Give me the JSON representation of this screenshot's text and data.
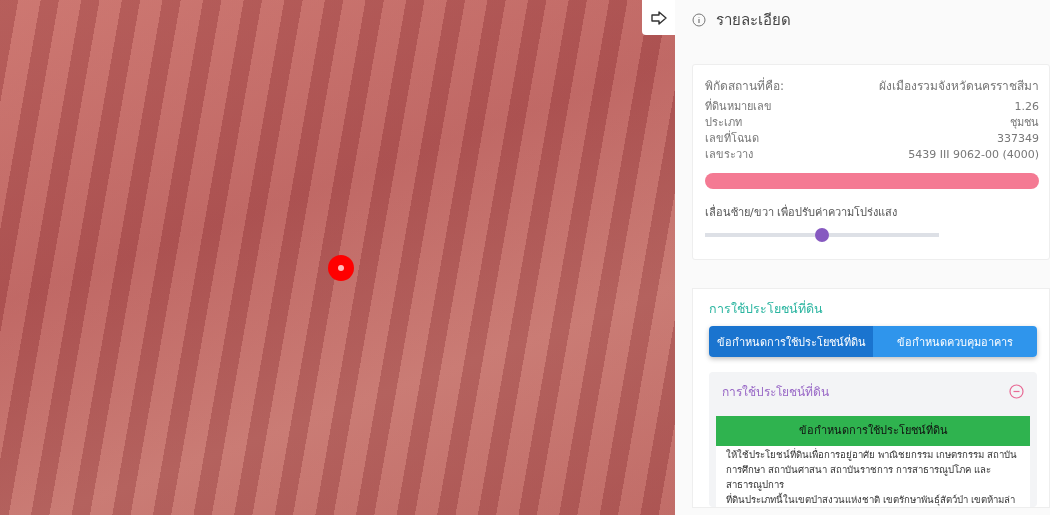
{
  "panel": {
    "title": "รายละเอียด",
    "location": {
      "label": "พิกัดสถานที่คือ:",
      "value": "ผังเมืองรวมจังหวัดนครราชสีมา",
      "rows": [
        {
          "label": "ที่ดินหมายเลข",
          "value": "1.26"
        },
        {
          "label": "ประเภท",
          "value": "ชุมชน"
        },
        {
          "label": "เลขที่โฉนด",
          "value": "337349"
        },
        {
          "label": "เลขระวาง",
          "value": "5439 III 9062-00 (4000)"
        }
      ],
      "zone_bar": {
        "color": "#f47a93"
      },
      "opacity_hint": "เลื่อนซ้าย/ขวา เพื่อปรับค่าความโปร่งแสง",
      "opacity_slider": {
        "level": 0.5
      }
    },
    "land_use": {
      "title": "การใช้ประโยชน์ที่ดิน",
      "tabs": [
        {
          "label": "ข้อกำหนดการใช้ประโยชน์ที่ดิน",
          "selected": true
        },
        {
          "label": "ข้อกำหนดควบคุมอาคาร",
          "selected": false
        }
      ],
      "section": {
        "title": "การใช้ประโยชน์ที่ดิน",
        "expanded": true,
        "header": "ข้อกำหนดการใช้ประโยชน์ที่ดิน",
        "paragraphs": [
          "ให้ใช้ประโยชน์ที่ดินเพื่อการอยู่อาศัย พาณิชยกรรม เกษตรกรรม สถาบันการศึกษา สถาบันศาสนา สถาบันราชการ การสาธารณูปโภค และสาธารณูปการ",
          "ที่ดินประเภทนี้ในเขตป่าสงวนแห่งชาติ เขตรักษาพันธุ์สัตว์ป่า เขตห้ามล่า"
        ]
      }
    }
  }
}
